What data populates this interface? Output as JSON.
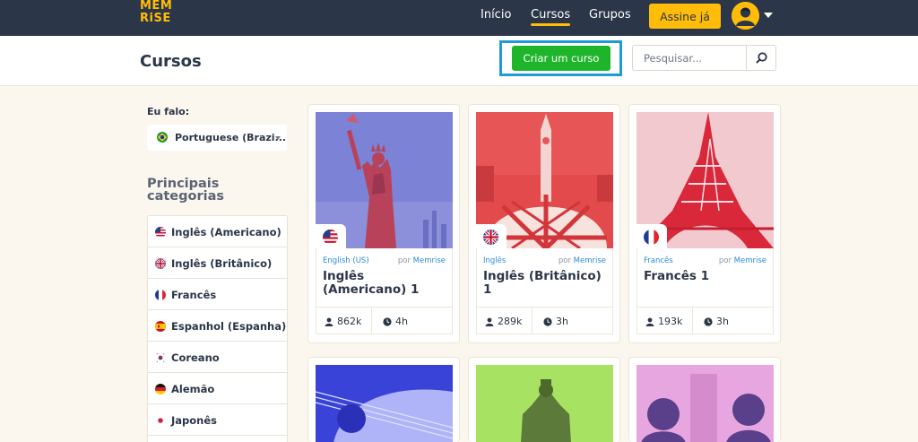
{
  "logo": {
    "line1": "MEM",
    "line2": "RiSE"
  },
  "nav": {
    "links": [
      {
        "label": "Início"
      },
      {
        "label": "Cursos",
        "active": true
      },
      {
        "label": "Grupos"
      }
    ],
    "subscribe_label": "Assine já",
    "accent": "#ffbc09"
  },
  "header": {
    "title": "Cursos",
    "create_label": "Criar um curso",
    "search_placeholder": "Pesquisar..."
  },
  "sidebar": {
    "speak_label": "Eu falo:",
    "speak_value": "Portuguese (Brazi...",
    "categories_title": "Principais categorias",
    "categories": [
      {
        "label": "Inglês (Americano)",
        "flag": "us-flag-icon"
      },
      {
        "label": "Inglês (Britânico)",
        "flag": "uk-flag-icon"
      },
      {
        "label": "Francês",
        "flag": "fr-flag-icon"
      },
      {
        "label": "Espanhol (Espanha)",
        "flag": "es-flag-icon"
      },
      {
        "label": "Coreano",
        "flag": "kr-flag-icon"
      },
      {
        "label": "Alemão",
        "flag": "de-flag-icon"
      },
      {
        "label": "Japonês",
        "flag": "jp-flag-icon"
      }
    ]
  },
  "courses": [
    {
      "lang": "English (US)",
      "by": "por",
      "author": "Memrise",
      "title": "Inglês (Americano) 1",
      "learners": "862k",
      "time": "4h",
      "flag": "us-flag-icon",
      "image": "statue-of-liberty"
    },
    {
      "lang": "Inglês",
      "by": "por",
      "author": "Memrise",
      "title": "Inglês (Britânico) 1",
      "learners": "289k",
      "time": "3h",
      "flag": "uk-flag-icon",
      "image": "big-ben"
    },
    {
      "lang": "Francês",
      "by": "por",
      "author": "Memrise",
      "title": "Francês 1",
      "learners": "193k",
      "time": "3h",
      "flag": "fr-flag-icon",
      "image": "eiffel-tower"
    }
  ],
  "courses_row2": [
    {
      "image": "guitar"
    },
    {
      "image": "statue-king"
    },
    {
      "image": "composers"
    }
  ]
}
